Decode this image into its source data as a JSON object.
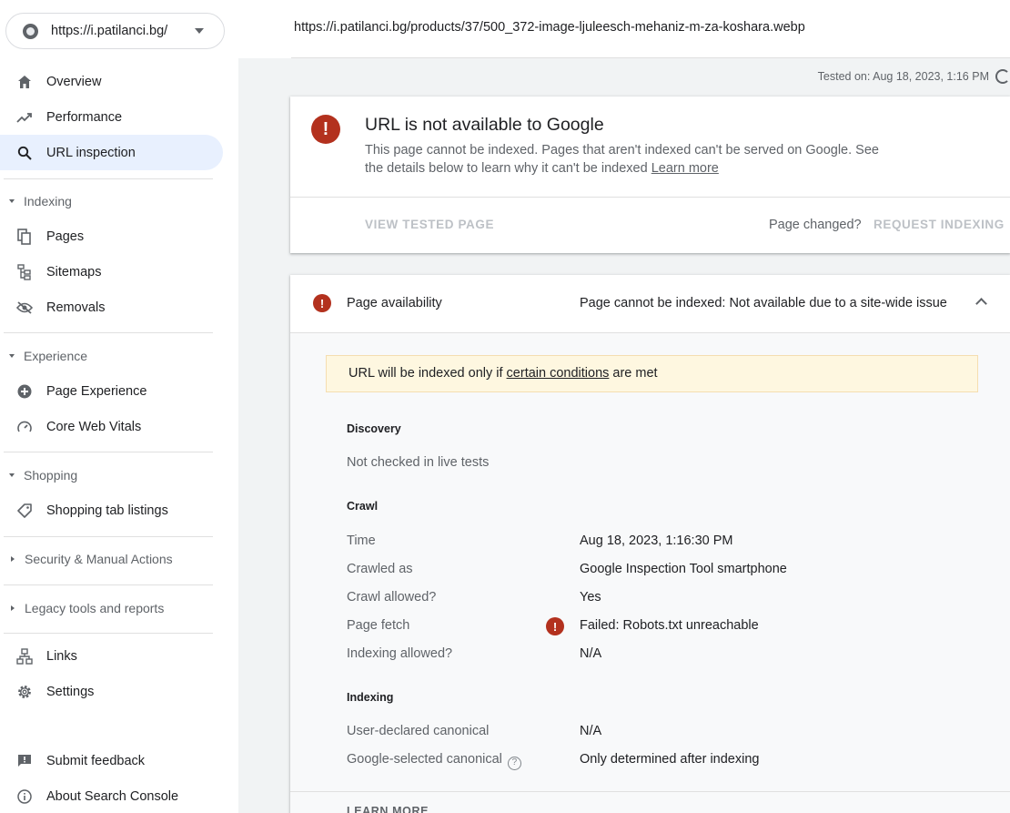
{
  "sidebar": {
    "property": "https://i.patilanci.bg/",
    "items": {
      "overview": "Overview",
      "performance": "Performance",
      "url_inspection": "URL inspection",
      "pages": "Pages",
      "sitemaps": "Sitemaps",
      "removals": "Removals",
      "page_experience": "Page Experience",
      "core_web_vitals": "Core Web Vitals",
      "shopping_tab_listings": "Shopping tab listings",
      "links": "Links",
      "settings": "Settings",
      "submit_feedback": "Submit feedback",
      "about": "About Search Console"
    },
    "sections": {
      "indexing": "Indexing",
      "experience": "Experience",
      "shopping": "Shopping",
      "security": "Security & Manual Actions",
      "legacy": "Legacy tools and reports"
    }
  },
  "header": {
    "inspected_url": "https://i.patilanci.bg/products/37/500_372-image-ljuleesch-mehaniz-m-za-koshara.webp",
    "tested_on": "Tested on: Aug 18, 2023, 1:16 PM"
  },
  "status_card": {
    "title": "URL is not available to Google",
    "desc": "This page cannot be indexed. Pages that aren't indexed can't be served on Google. See the details below to learn why it can't be indexed",
    "learn_more": "Learn more",
    "view_tested_page": "VIEW TESTED PAGE",
    "page_changed": "Page changed?",
    "request_indexing": "REQUEST INDEXING"
  },
  "availability": {
    "label": "Page availability",
    "value": "Page cannot be indexed: Not available due to a site-wide issue",
    "note_prefix": "URL will be indexed only if ",
    "note_link": "certain conditions",
    "note_suffix": " are met",
    "discovery": {
      "heading": "Discovery",
      "text": "Not checked in live tests"
    },
    "crawl": {
      "heading": "Crawl",
      "time_label": "Time",
      "time_value": "Aug 18, 2023, 1:16:30 PM",
      "crawled_as_label": "Crawled as",
      "crawled_as_value": "Google Inspection Tool smartphone",
      "crawl_allowed_label": "Crawl allowed?",
      "crawl_allowed_value": "Yes",
      "page_fetch_label": "Page fetch",
      "page_fetch_value": "Failed: Robots.txt unreachable",
      "indexing_allowed_label": "Indexing allowed?",
      "indexing_allowed_value": "N/A"
    },
    "indexing": {
      "heading": "Indexing",
      "user_canonical_label": "User-declared canonical",
      "user_canonical_value": "N/A",
      "google_canonical_label": "Google-selected canonical",
      "google_canonical_value": "Only determined after indexing"
    },
    "learn_more": "LEARN MORE"
  },
  "colors": {
    "error": "#b3311e",
    "active_nav": "#e8f0fe",
    "note_bg": "#fef7e0"
  }
}
